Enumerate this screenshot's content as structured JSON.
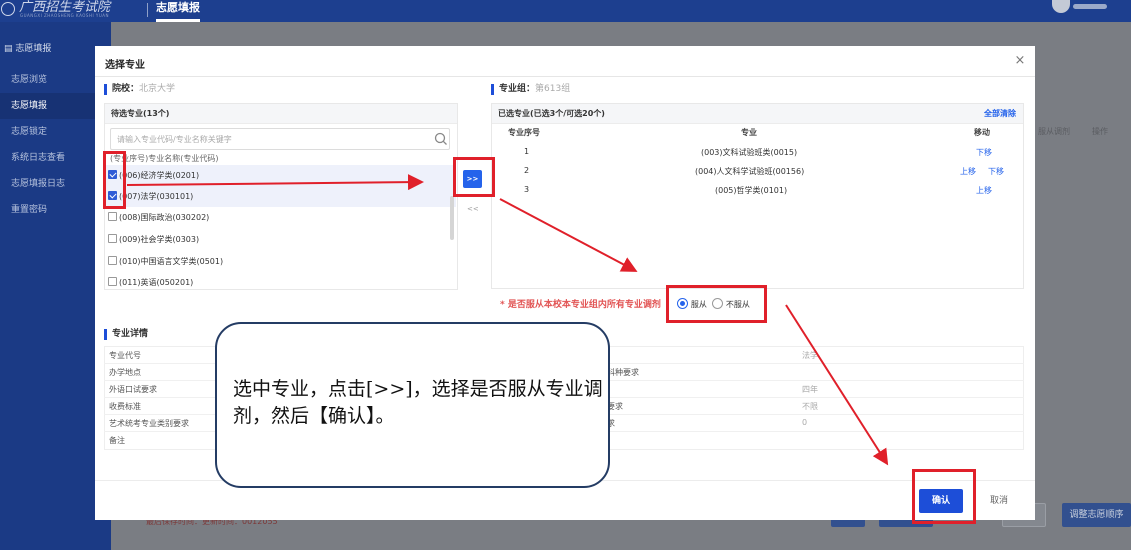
{
  "topbar": {
    "logo_text": "广西招生考试院",
    "logo_sub": "GUANGXI ZHAOSHENG KAOSHI YUAN",
    "nav_label": "志愿填报"
  },
  "sidebar": {
    "items": [
      {
        "label": "志愿填报"
      },
      {
        "label": "志愿浏览"
      },
      {
        "label": "志愿填报"
      },
      {
        "label": "志愿锁定"
      },
      {
        "label": "系统日志查看"
      },
      {
        "label": "志愿填报日志"
      },
      {
        "label": "重置密码"
      }
    ]
  },
  "background": {
    "col_adjust": "服从调剂",
    "col_action": "操作",
    "footnote": "最后保存时间：更新时间：0012055",
    "btn_adjust_order": "调整志愿顺序"
  },
  "modal": {
    "title": "选择专业",
    "close_glyph": "×",
    "school_label": "院校：",
    "school_value": "北京大学",
    "group_label": "专业组：",
    "group_value": "第613组",
    "pending": {
      "title": "待选专业(13个)",
      "search_placeholder": "请输入专业代码/专业名称关键字",
      "caption": "(专业序号)专业名称(专业代码)",
      "options": [
        {
          "label": "(006)经济学类(0201)"
        },
        {
          "label": "(007)法学(030101)"
        },
        {
          "label": "(008)国际政治(030202)"
        },
        {
          "label": "(009)社会学类(0303)"
        },
        {
          "label": "(010)中国语言文学类(0501)"
        },
        {
          "label": "(011)英语(050201)"
        }
      ]
    },
    "move_right_label": ">>",
    "move_left_label": "<<",
    "selected": {
      "title": "已选专业(已选3个/可选20个)",
      "clear_all": "全部清除",
      "headers": {
        "seq": "专业序号",
        "major": "专业",
        "move": "移动"
      },
      "rows": [
        {
          "seq": "1",
          "major": "(003)文科试验班类(0015)",
          "up": "",
          "down": "下移"
        },
        {
          "seq": "2",
          "major": "(004)人文科学试验班(00156)",
          "up": "上移",
          "down": "下移"
        },
        {
          "seq": "3",
          "major": "(005)哲学类(0101)",
          "up": "上移",
          "down": ""
        }
      ]
    },
    "obey_question": "* 是否服从本校本专业组内所有专业调剂",
    "obey_yes": "服从",
    "obey_no": "不服从",
    "detail": {
      "title": "专业详情",
      "labels": [
        "专业代号",
        "办学地点",
        "外语口试要求",
        "收费标准",
        "艺术统考专业类别要求",
        "备注"
      ],
      "right_labels": [
        "科种要求",
        "要求",
        "求"
      ],
      "right_values": [
        "法学",
        "四年",
        "不限",
        "0"
      ]
    },
    "confirm_label": "确认",
    "cancel_label": "取消"
  },
  "annotation": {
    "callout_text": "选中专业，点击[>>]，选择是否服从专业调剂，然后【确认】。"
  },
  "colors": {
    "brand": "#1d3f8f",
    "accent": "#1d4ed8",
    "highlight": "#e0202a"
  }
}
